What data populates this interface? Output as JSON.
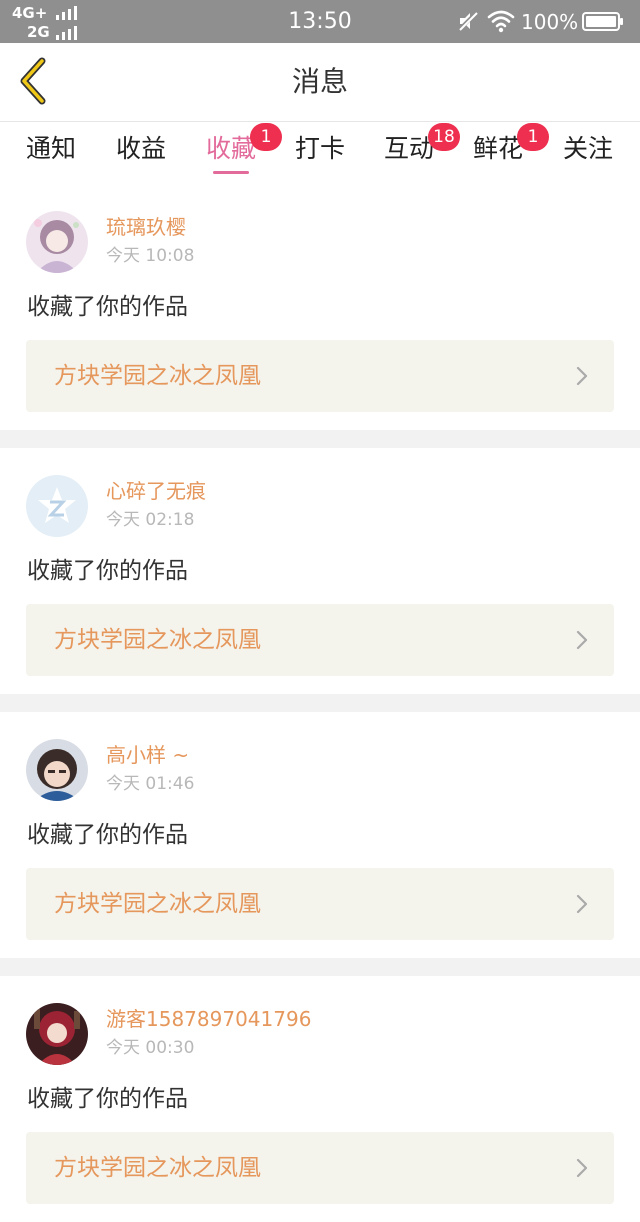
{
  "status_bar": {
    "network_1": "4G+",
    "network_2": "2G",
    "time": "13:50",
    "battery": "100%",
    "icons": [
      "signal-icon",
      "mute-icon",
      "wifi-icon",
      "battery-icon"
    ]
  },
  "nav": {
    "back_icon": "chevron-left-icon",
    "title": "消息"
  },
  "tabs": [
    {
      "label": "通知"
    },
    {
      "label": "收益"
    },
    {
      "label": "收藏",
      "badge": "1",
      "active": true
    },
    {
      "label": "打卡"
    },
    {
      "label": "互动",
      "badge": "18"
    },
    {
      "label": "鲜花",
      "badge": "1"
    },
    {
      "label": "关注"
    }
  ],
  "feed": [
    {
      "username": "琉璃玖樱",
      "time": "今天 10:08",
      "action": "收藏了你的作品",
      "work": "方块学园之冰之凤凰"
    },
    {
      "username": "心碎了无痕",
      "time": "今天 02:18",
      "action": "收藏了你的作品",
      "work": "方块学园之冰之凤凰"
    },
    {
      "username": "高小样 ~",
      "time": "今天 01:46",
      "action": "收藏了你的作品",
      "work": "方块学园之冰之凤凰"
    },
    {
      "username": "游客1587897041796",
      "time": "今天 00:30",
      "action": "收藏了你的作品",
      "work": "方块学园之冰之凤凰"
    }
  ],
  "colors": {
    "accent_pink": "#e36b9b",
    "name_orange": "#e5975c",
    "badge_red": "#ee2f4f",
    "status_bar_gray": "#8f8f8f",
    "link_bg": "#f4f3ec",
    "back_arrow": "#f0c818"
  }
}
